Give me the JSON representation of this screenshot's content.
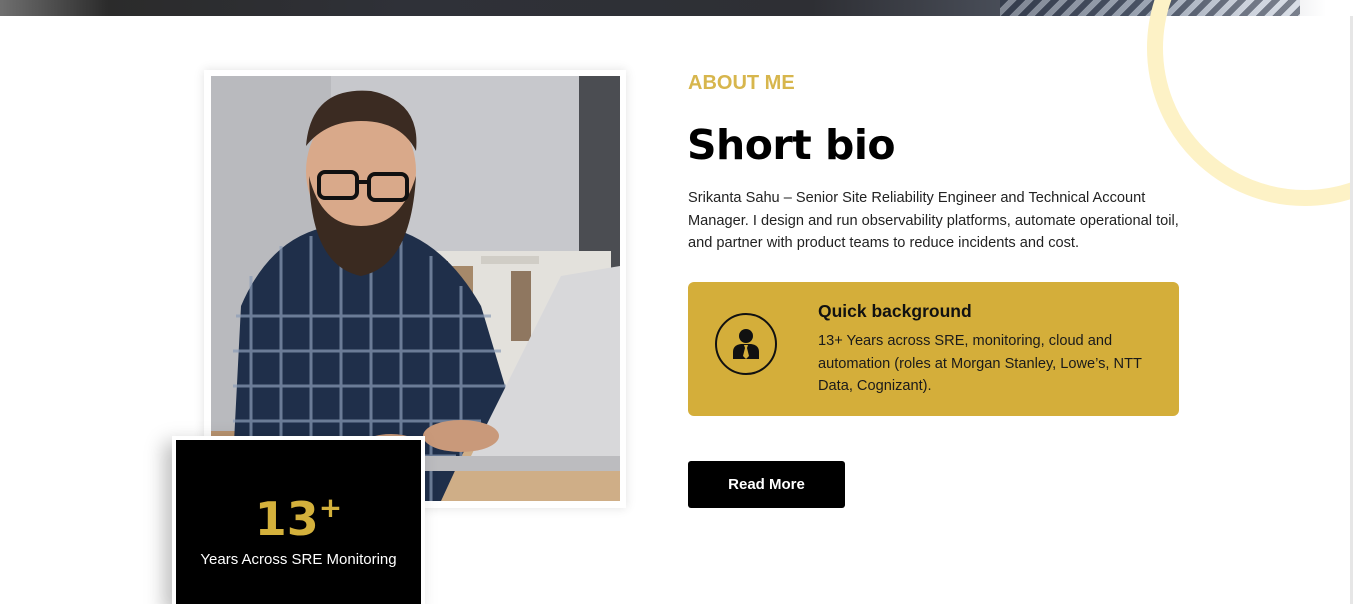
{
  "about": {
    "eyebrow": "ABOUT ME",
    "heading": "Short bio",
    "bio": "Srikanta Sahu – Senior Site Reliability Engineer and Technical Account Manager. I design and run observability platforms, automate operational toil, and partner with product teams to reduce incidents and cost."
  },
  "stat": {
    "number": "13",
    "suffix": "+",
    "label": "Years Across SRE Monitoring"
  },
  "background_card": {
    "icon": "user-tie-icon",
    "title": "Quick background",
    "text": "13+ Years across SRE, monitoring, cloud and automation (roles at Morgan Stanley, Lowe’s, NTT Data, Cognizant)."
  },
  "cta": {
    "read_more": "Read More"
  },
  "colors": {
    "accent": "#d4ae3a",
    "eyebrow": "#d7b64d",
    "ring": "#fdf2c6",
    "dark": "#000000"
  }
}
